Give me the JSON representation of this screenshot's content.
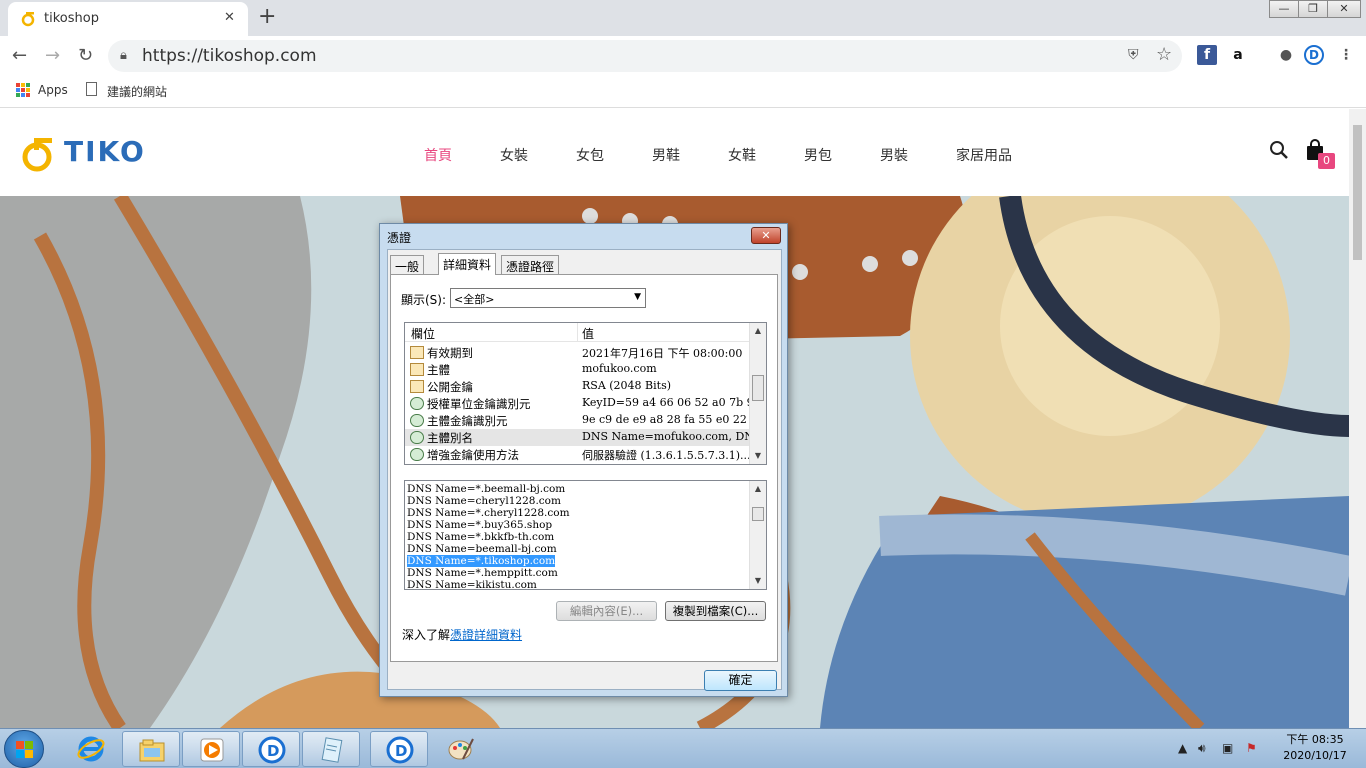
{
  "browser": {
    "tab_title": "tikoshop",
    "tab_close": "✕",
    "new_tab": "+",
    "url": "https://tikoshop.com",
    "window_controls": [
      "—",
      "❐",
      "✕"
    ],
    "bookmarks": {
      "apps": "Apps",
      "suggested": "建議的網站"
    },
    "extensions": [
      "facebook-icon",
      "amazon-icon",
      "account-icon",
      "dashlane-icon",
      "menu-icon"
    ]
  },
  "site": {
    "logo_text": "TIKO",
    "brand_color": "#2b6cb8",
    "logo_mark_color": "#f4b400",
    "menu": [
      "首頁",
      "女裝",
      "女包",
      "男鞋",
      "女鞋",
      "男包",
      "男裝",
      "家居用品"
    ],
    "menu_active_color": "#e8477f",
    "cart_count": "0"
  },
  "dialog": {
    "title": "憑證",
    "close": "✕",
    "tabs": [
      "一般",
      "詳細資料",
      "憑證路徑"
    ],
    "active_tab": "詳細資料",
    "show_label": "顯示(S):",
    "show_value": "<全部>",
    "columns": [
      "欄位",
      "值"
    ],
    "fields": [
      {
        "name": "有效期到",
        "value": "2021年7月16日 下午 08:00:00",
        "icon": "doc"
      },
      {
        "name": "主體",
        "value": "mofukoo.com",
        "icon": "doc"
      },
      {
        "name": "公開金鑰",
        "value": "RSA (2048 Bits)",
        "icon": "doc"
      },
      {
        "name": "授權單位金鑰識別元",
        "value": "KeyID=59 a4 66 06 52 a0 7b 9...",
        "icon": "ext"
      },
      {
        "name": "主體金鑰識別元",
        "value": "9e c9 de e9 a8 28 fa 55 e0 22 e...",
        "icon": "ext"
      },
      {
        "name": "主體別名",
        "value": "DNS Name=mofukoo.com, DN...",
        "icon": "ext",
        "selected": true
      },
      {
        "name": "增強金鑰使用方法",
        "value": "伺服器驗證 (1.3.6.1.5.5.7.3.1)...",
        "icon": "ext"
      }
    ],
    "dns_values": [
      "DNS Name=*.beemall-bj.com",
      "DNS Name=cheryl1228.com",
      "DNS Name=*.cheryl1228.com",
      "DNS Name=*.buy365.shop",
      "DNS Name=*.bkkfb-th.com",
      "DNS Name=beemall-bj.com",
      "DNS Name=*.tikoshop.com",
      "DNS Name=*.hemppitt.com",
      "DNS Name=kikistu.com"
    ],
    "selected_dns_index": 6,
    "edit_button": "編輯內容(E)...",
    "copy_button": "複製到檔案(C)...",
    "learn_prefix": "深入了解",
    "learn_link": "憑證詳細資料",
    "ok_button": "確定"
  },
  "taskbar": {
    "time": "下午 08:35",
    "date": "2020/10/17",
    "apps": [
      "ie-icon",
      "explorer-icon",
      "media-player-icon",
      "dashlane-icon",
      "notepad-icon",
      "dashlane-icon",
      "paint-icon"
    ]
  }
}
